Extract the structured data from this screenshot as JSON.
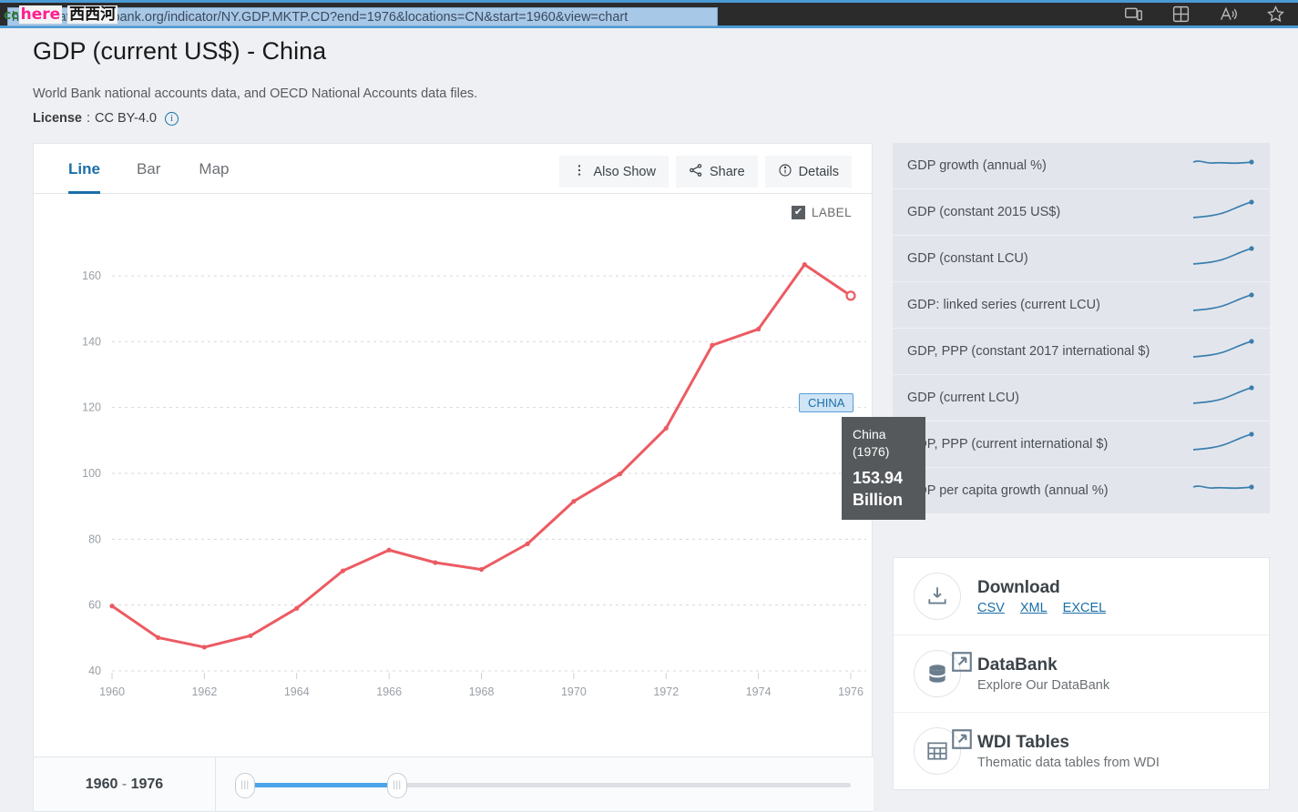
{
  "browser": {
    "url": "https://data.worldbank.org/indicator/NY.GDP.MKTP.CD?end=1976&locations=CN&start=1960&view=chart",
    "icons": [
      "cast-device-icon",
      "collections-grid-icon",
      "read-aloud-icon",
      "favorites-star-icon"
    ]
  },
  "watermark": {
    "cc": "cc",
    "here": "here",
    "cn": "西西河"
  },
  "header": {
    "title": "GDP (current US$) - China",
    "subtitle": "World Bank national accounts data, and OECD National Accounts data files.",
    "license_label": "License",
    "license_sep": ":",
    "license_value": "CC BY-4.0"
  },
  "chart_panel": {
    "tabs": [
      {
        "label": "Line",
        "active": true
      },
      {
        "label": "Bar",
        "active": false
      },
      {
        "label": "Map",
        "active": false
      }
    ],
    "buttons": [
      {
        "label": "Also Show",
        "icon": "kebab-menu-icon"
      },
      {
        "label": "Share",
        "icon": "share-icon"
      },
      {
        "label": "Details",
        "icon": "info-icon"
      }
    ],
    "label_toggle": {
      "text": "LABEL",
      "checked": true,
      "check_glyph": "✔"
    },
    "series_badge": "CHINA",
    "tooltip": {
      "name": "China",
      "year": "(1976)",
      "value": "153.94",
      "unit": "Billion"
    },
    "slider": {
      "start_year": "1960",
      "dash": "-",
      "end_year": "1976",
      "handle_glyph": "|||"
    }
  },
  "chart_data": {
    "type": "line",
    "title": "GDP (current US$) - China",
    "xlabel": "",
    "ylabel": "",
    "unit": "Billion US$",
    "grid": true,
    "legend": "CHINA",
    "line_color": "#ec5b62",
    "xlim": [
      1960,
      1976
    ],
    "ylim": [
      40,
      168
    ],
    "yticks": [
      40,
      60,
      80,
      100,
      120,
      140,
      160
    ],
    "xticks": [
      1960,
      1962,
      1964,
      1966,
      1968,
      1970,
      1972,
      1974,
      1976
    ],
    "x": [
      1960,
      1961,
      1962,
      1963,
      1964,
      1965,
      1966,
      1967,
      1968,
      1969,
      1970,
      1971,
      1972,
      1973,
      1974,
      1975,
      1976
    ],
    "series": [
      {
        "name": "China",
        "values": [
          59.7,
          50.1,
          47.2,
          50.7,
          59.0,
          70.4,
          76.7,
          72.9,
          70.8,
          78.6,
          91.5,
          99.8,
          113.7,
          138.9,
          143.8,
          163.4,
          153.94
        ]
      }
    ],
    "highlight": {
      "x": 1976,
      "y": 153.94,
      "label": "China (1976) 153.94 Billion"
    }
  },
  "related_indicators": [
    {
      "label": "GDP growth (annual %)",
      "spark": "flat"
    },
    {
      "label": "GDP (constant 2015 US$)",
      "spark": "rise"
    },
    {
      "label": "GDP (constant LCU)",
      "spark": "rise"
    },
    {
      "label": "GDP: linked series (current LCU)",
      "spark": "rise"
    },
    {
      "label": "GDP, PPP (constant 2017 international $)",
      "spark": "rise"
    },
    {
      "label": "GDP (current LCU)",
      "spark": "rise"
    },
    {
      "label": "GDP, PPP (current international $)",
      "spark": "rise"
    },
    {
      "label": "GDP per capita growth (annual %)",
      "spark": "flat"
    }
  ],
  "links": [
    {
      "icon": "download-icon",
      "title": "Download",
      "formats": [
        "CSV",
        "XML",
        "EXCEL"
      ],
      "external": false
    },
    {
      "icon": "database-icon",
      "title": "DataBank",
      "subtitle": "Explore Our DataBank",
      "external": true
    },
    {
      "icon": "table-grid-icon",
      "title": "WDI Tables",
      "subtitle": "Thematic data tables from WDI",
      "external": true
    }
  ],
  "colors": {
    "accent_blue": "#1a6fa8",
    "line_red": "#ec5b62",
    "spark_blue": "#3b7fae",
    "tooltip_bg": "#55595c",
    "chrome_dark": "#2b2b2b",
    "chrome_blue": "#4a9ad4"
  }
}
